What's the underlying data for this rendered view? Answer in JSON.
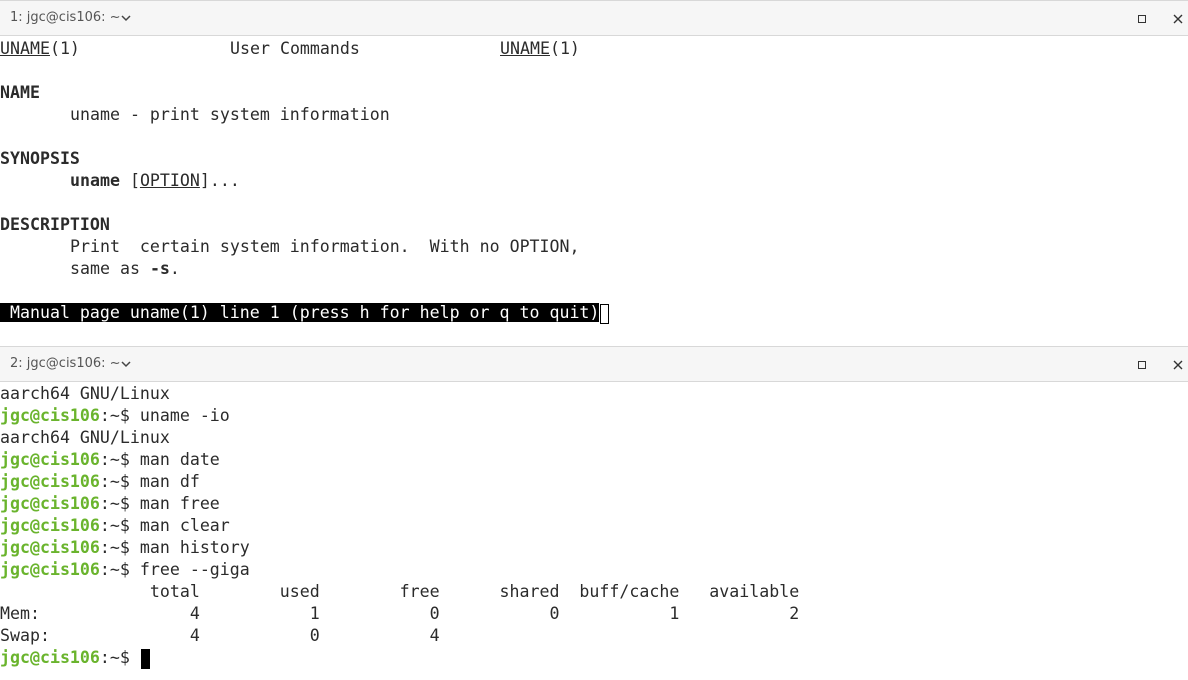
{
  "pane1": {
    "title": "1: jgc@cis106: ~",
    "man_header": {
      "left": "UNAME",
      "left_sec": "(1)",
      "center": "User Commands",
      "right": "UNAME",
      "right_sec": "(1)"
    },
    "name_heading": "NAME",
    "name_text": "uname - print system information",
    "synopsis_heading": "SYNOPSIS",
    "synopsis_cmd": "uname",
    "synopsis_bracket_open": " [",
    "synopsis_option": "OPTION",
    "synopsis_rest": "]...",
    "description_heading": "DESCRIPTION",
    "description_line1": "Print  certain system information.  With no OPTION,",
    "description_line2_pre": "same as ",
    "description_line2_flag": "-s",
    "description_line2_post": ".",
    "status_line": " Manual page uname(1) line 1 (press h for help or q to quit)"
  },
  "pane2": {
    "title": "2: jgc@cis106: ~",
    "prompt_user": "jgc@cis106",
    "prompt_path": ":~$ ",
    "lines": [
      {
        "type": "output",
        "text": "aarch64 GNU/Linux"
      },
      {
        "type": "cmd",
        "text": "uname -io"
      },
      {
        "type": "output",
        "text": "aarch64 GNU/Linux"
      },
      {
        "type": "cmd",
        "text": "man date"
      },
      {
        "type": "cmd",
        "text": "man df"
      },
      {
        "type": "cmd",
        "text": "man free"
      },
      {
        "type": "cmd",
        "text": "man clear"
      },
      {
        "type": "cmd",
        "text": "man history"
      },
      {
        "type": "cmd",
        "text": "free --giga"
      },
      {
        "type": "output",
        "text": "               total        used        free      shared  buff/cache   available"
      },
      {
        "type": "output",
        "text": "Mem:               4           1           0           0           1           2"
      },
      {
        "type": "output",
        "text": "Swap:              4           0           4"
      },
      {
        "type": "prompt",
        "text": ""
      }
    ]
  },
  "icons": {
    "maximize": "maximize-icon",
    "close": "close-icon",
    "chevron": "chevron-down-icon",
    "close_glyph": "✕"
  },
  "colors": {
    "prompt_green": "#6ab42d",
    "status_bg": "#000000",
    "titlebar_bg": "#f6f6f6"
  }
}
